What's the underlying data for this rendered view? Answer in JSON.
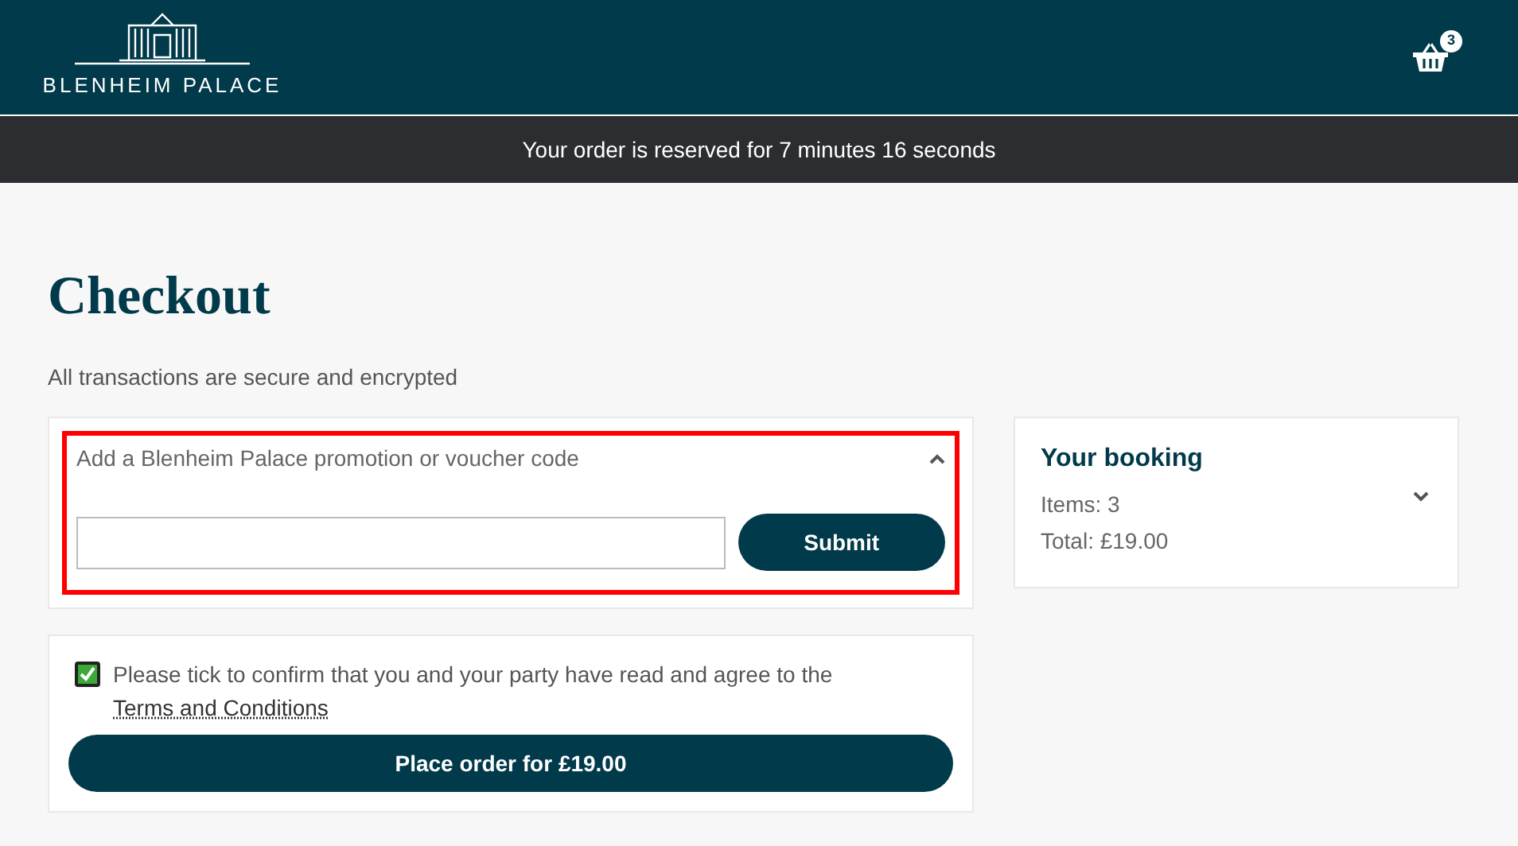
{
  "header": {
    "logo_text": "BLENHEIM PALACE",
    "basket_count": "3"
  },
  "reservation_bar": {
    "text": "Your order is reserved for 7 minutes 16 seconds"
  },
  "page": {
    "title": "Checkout",
    "subtitle": "All transactions are secure and encrypted"
  },
  "promo": {
    "label": "Add a Blenheim Palace promotion or voucher code",
    "expanded": true,
    "highlighted": true,
    "button": "Submit"
  },
  "terms": {
    "checked": true,
    "text": "Please tick to confirm that you and your party have read and agree to the ",
    "link": "Terms and Conditions",
    "button": "Place order for £19.00"
  },
  "booking": {
    "title": "Your booking",
    "items": "Items: 3",
    "total": "Total: £19.00",
    "expanded": false
  }
}
